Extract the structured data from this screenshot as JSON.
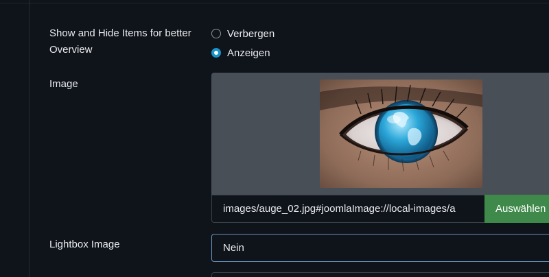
{
  "show_hide": {
    "label": "Show and Hide Items for better Overview",
    "options": [
      {
        "label": "Verbergen",
        "checked": false
      },
      {
        "label": "Anzeigen",
        "checked": true
      }
    ]
  },
  "image": {
    "label": "Image",
    "path_value": "images/auge_02.jpg#joomlaImage://local-images/a",
    "select_label": "Auswählen"
  },
  "lightbox": {
    "label": "Lightbox Image",
    "value": "Nein"
  },
  "colors": {
    "accent": "#1b93c9",
    "button_green": "#3f8a4a",
    "background": "#0f131a"
  }
}
